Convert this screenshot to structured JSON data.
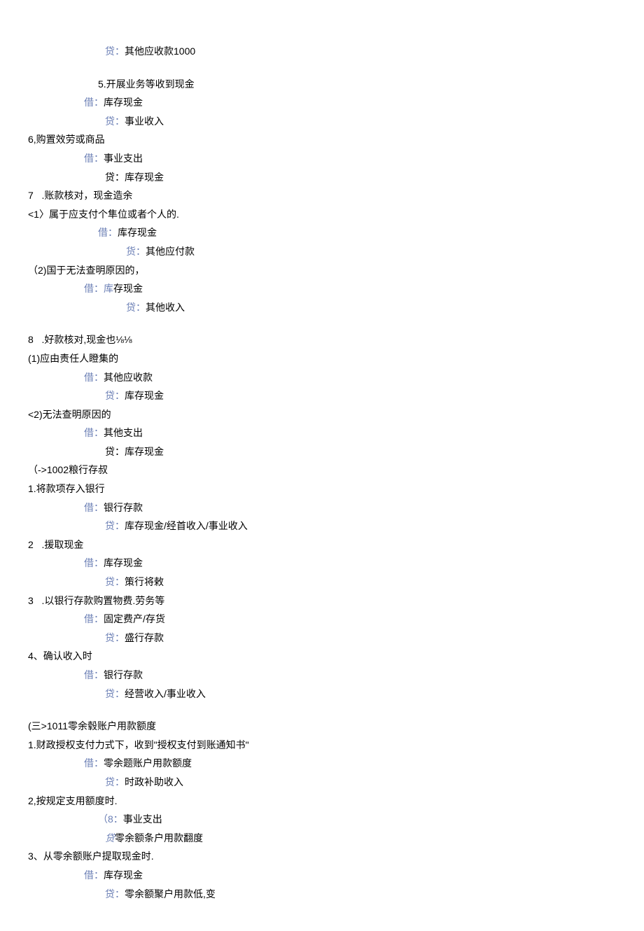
{
  "lines": [
    {
      "cls": "indent3",
      "kw": "贷：",
      "text": "其他应收款1000"
    },
    {
      "cls": "spacer",
      "text": ""
    },
    {
      "cls": "indent2",
      "kw": "",
      "text": "5.开展业务等收到现金"
    },
    {
      "cls": "indent1",
      "kw": "借：",
      "text": "库存现金"
    },
    {
      "cls": "indent3",
      "kw": "贷：",
      "text": "事业收入"
    },
    {
      "cls": "left0",
      "kw": "",
      "text": "6,购置效劳或商品"
    },
    {
      "cls": "indent1",
      "kw": "借：",
      "text": "事业支出"
    },
    {
      "cls": "indent3",
      "kw": "",
      "text": "贷：库存现金"
    },
    {
      "cls": "left0",
      "kw": "",
      "text": "7   .账款核对，现金造余"
    },
    {
      "cls": "left0",
      "kw": "",
      "text": "<1〉属于应支付个隼位或者个人的."
    },
    {
      "cls": "indent2",
      "kw": "借：",
      "text": "库存现金"
    },
    {
      "cls": "indent4",
      "kw": "货：",
      "text": "其他应付款"
    },
    {
      "cls": "left0",
      "kw": "",
      "text": "（2)国于无法查明原因的，"
    },
    {
      "cls": "indent1",
      "kw": "借：库",
      "text": "存现金"
    },
    {
      "cls": "indent4",
      "kw": "贷：",
      "text": "其他收入"
    },
    {
      "cls": "spacer",
      "text": ""
    },
    {
      "cls": "left0",
      "kw": "",
      "text": "8   .好款核对,现金也⅛⅛"
    },
    {
      "cls": "left0",
      "kw": "",
      "text": "(1)应由责任人瞪集的"
    },
    {
      "cls": "indent1",
      "kw": "借：",
      "text": "其他应收款"
    },
    {
      "cls": "indent3",
      "kw": "贷：",
      "text": "库存现金"
    },
    {
      "cls": "left0",
      "kw": "",
      "text": "<2)无法查明原因的"
    },
    {
      "cls": "indent1",
      "kw": "借：",
      "text": "其他支出"
    },
    {
      "cls": "indent3",
      "kw": "",
      "text": "贷：库存现金"
    },
    {
      "cls": "left0",
      "kw": "",
      "text": "（->1002粮行存叔"
    },
    {
      "cls": "left0",
      "kw": "",
      "text": "1.将款项存入银行"
    },
    {
      "cls": "indent1",
      "kw": "借：",
      "text": "银行存款"
    },
    {
      "cls": "indent3",
      "kw": "贷：",
      "text": "库存现金/经首收入/事业收入"
    },
    {
      "cls": "left0",
      "kw": "",
      "text": "2   .援取现金"
    },
    {
      "cls": "indent1",
      "kw": "借：",
      "text": "库存现金"
    },
    {
      "cls": "indent3",
      "kw": "贷：",
      "text": "策行将敕"
    },
    {
      "cls": "left0",
      "kw": "",
      "text": "3   .以银行存款购置物费.劳务等"
    },
    {
      "cls": "indent1",
      "kw": "借：",
      "text": "固定费产/存货"
    },
    {
      "cls": "indent3",
      "kw": "贷：",
      "text": "盛行存款"
    },
    {
      "cls": "left0",
      "kw": "",
      "text": "4、确认收入时"
    },
    {
      "cls": "indent1",
      "kw": "借：",
      "text": "银行存款"
    },
    {
      "cls": "indent3",
      "kw": "贷：",
      "text": "经营收入/事业收入"
    },
    {
      "cls": "spacer",
      "text": ""
    },
    {
      "cls": "left0",
      "kw": "",
      "text": "(三>1011零余毂账户用款额度"
    },
    {
      "cls": "left0",
      "kw": "",
      "text": "1.财政授权支付力式下，收到\"授权支付到账通知书\""
    },
    {
      "cls": "indent1",
      "kw": "借：",
      "text": "零余题账户用款额度"
    },
    {
      "cls": "indent3",
      "kw": "贷：",
      "text": "时政补助收入"
    },
    {
      "cls": "left0",
      "kw": "",
      "text": "2,按规定支用额度时."
    },
    {
      "cls": "indent2",
      "kw": "（8：",
      "text": "事业支出"
    },
    {
      "cls": "indent3",
      "kw": "贷",
      "text": "零余额条户用款翻度",
      "italic": true
    },
    {
      "cls": "left0",
      "kw": "",
      "text": "3、从零余额账户提取现金时."
    },
    {
      "cls": "indent1",
      "kw": "借：",
      "text": "库存现金"
    },
    {
      "cls": "indent3",
      "kw": "贷：",
      "text": "零余额聚户用款低,变"
    }
  ]
}
